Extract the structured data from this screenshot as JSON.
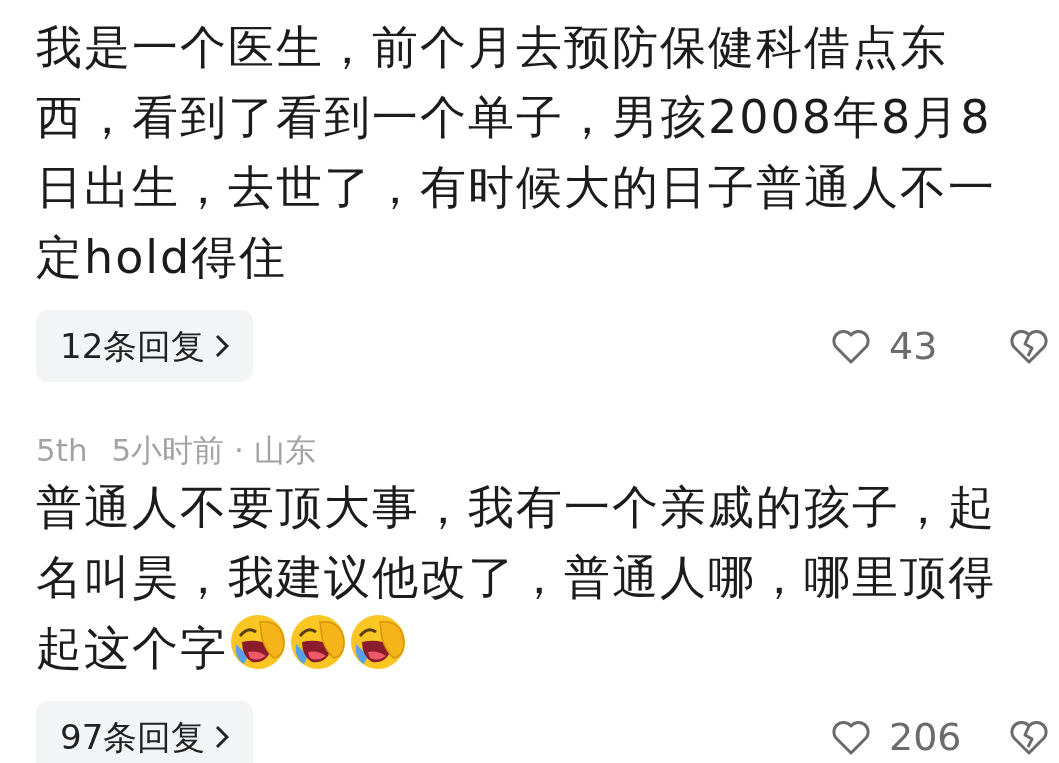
{
  "comments": [
    {
      "text": "我是一个医生，前个月去预防保健科借点东西，看到了看到一个单子，男孩2008年8月8日出生，去世了，有时候大的日子普通人不一定hold得住",
      "replies": "12条回复",
      "likes": "43"
    },
    {
      "floor": "5th",
      "time_location": "5小时前 · 山东",
      "text": "普通人不要顶大事，我有一个亲戚的孩子，起名叫昊，我建议他改了，普通人哪，哪里顶得起这个字",
      "emojis": [
        {
          "kind": "facepalm-laugh"
        },
        {
          "kind": "facepalm-laugh"
        },
        {
          "kind": "facepalm-laugh"
        }
      ],
      "replies": "97条回复",
      "likes": "206"
    }
  ]
}
